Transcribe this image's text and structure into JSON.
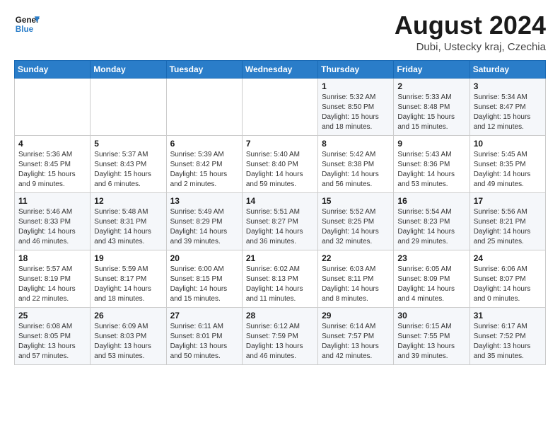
{
  "header": {
    "logo": {
      "line1": "General",
      "line2": "Blue"
    },
    "title": "August 2024",
    "subtitle": "Dubi, Ustecky kraj, Czechia"
  },
  "weekdays": [
    "Sunday",
    "Monday",
    "Tuesday",
    "Wednesday",
    "Thursday",
    "Friday",
    "Saturday"
  ],
  "weeks": [
    [
      {
        "day": "",
        "info": ""
      },
      {
        "day": "",
        "info": ""
      },
      {
        "day": "",
        "info": ""
      },
      {
        "day": "",
        "info": ""
      },
      {
        "day": "1",
        "info": "Sunrise: 5:32 AM\nSunset: 8:50 PM\nDaylight: 15 hours\nand 18 minutes."
      },
      {
        "day": "2",
        "info": "Sunrise: 5:33 AM\nSunset: 8:48 PM\nDaylight: 15 hours\nand 15 minutes."
      },
      {
        "day": "3",
        "info": "Sunrise: 5:34 AM\nSunset: 8:47 PM\nDaylight: 15 hours\nand 12 minutes."
      }
    ],
    [
      {
        "day": "4",
        "info": "Sunrise: 5:36 AM\nSunset: 8:45 PM\nDaylight: 15 hours\nand 9 minutes."
      },
      {
        "day": "5",
        "info": "Sunrise: 5:37 AM\nSunset: 8:43 PM\nDaylight: 15 hours\nand 6 minutes."
      },
      {
        "day": "6",
        "info": "Sunrise: 5:39 AM\nSunset: 8:42 PM\nDaylight: 15 hours\nand 2 minutes."
      },
      {
        "day": "7",
        "info": "Sunrise: 5:40 AM\nSunset: 8:40 PM\nDaylight: 14 hours\nand 59 minutes."
      },
      {
        "day": "8",
        "info": "Sunrise: 5:42 AM\nSunset: 8:38 PM\nDaylight: 14 hours\nand 56 minutes."
      },
      {
        "day": "9",
        "info": "Sunrise: 5:43 AM\nSunset: 8:36 PM\nDaylight: 14 hours\nand 53 minutes."
      },
      {
        "day": "10",
        "info": "Sunrise: 5:45 AM\nSunset: 8:35 PM\nDaylight: 14 hours\nand 49 minutes."
      }
    ],
    [
      {
        "day": "11",
        "info": "Sunrise: 5:46 AM\nSunset: 8:33 PM\nDaylight: 14 hours\nand 46 minutes."
      },
      {
        "day": "12",
        "info": "Sunrise: 5:48 AM\nSunset: 8:31 PM\nDaylight: 14 hours\nand 43 minutes."
      },
      {
        "day": "13",
        "info": "Sunrise: 5:49 AM\nSunset: 8:29 PM\nDaylight: 14 hours\nand 39 minutes."
      },
      {
        "day": "14",
        "info": "Sunrise: 5:51 AM\nSunset: 8:27 PM\nDaylight: 14 hours\nand 36 minutes."
      },
      {
        "day": "15",
        "info": "Sunrise: 5:52 AM\nSunset: 8:25 PM\nDaylight: 14 hours\nand 32 minutes."
      },
      {
        "day": "16",
        "info": "Sunrise: 5:54 AM\nSunset: 8:23 PM\nDaylight: 14 hours\nand 29 minutes."
      },
      {
        "day": "17",
        "info": "Sunrise: 5:56 AM\nSunset: 8:21 PM\nDaylight: 14 hours\nand 25 minutes."
      }
    ],
    [
      {
        "day": "18",
        "info": "Sunrise: 5:57 AM\nSunset: 8:19 PM\nDaylight: 14 hours\nand 22 minutes."
      },
      {
        "day": "19",
        "info": "Sunrise: 5:59 AM\nSunset: 8:17 PM\nDaylight: 14 hours\nand 18 minutes."
      },
      {
        "day": "20",
        "info": "Sunrise: 6:00 AM\nSunset: 8:15 PM\nDaylight: 14 hours\nand 15 minutes."
      },
      {
        "day": "21",
        "info": "Sunrise: 6:02 AM\nSunset: 8:13 PM\nDaylight: 14 hours\nand 11 minutes."
      },
      {
        "day": "22",
        "info": "Sunrise: 6:03 AM\nSunset: 8:11 PM\nDaylight: 14 hours\nand 8 minutes."
      },
      {
        "day": "23",
        "info": "Sunrise: 6:05 AM\nSunset: 8:09 PM\nDaylight: 14 hours\nand 4 minutes."
      },
      {
        "day": "24",
        "info": "Sunrise: 6:06 AM\nSunset: 8:07 PM\nDaylight: 14 hours\nand 0 minutes."
      }
    ],
    [
      {
        "day": "25",
        "info": "Sunrise: 6:08 AM\nSunset: 8:05 PM\nDaylight: 13 hours\nand 57 minutes."
      },
      {
        "day": "26",
        "info": "Sunrise: 6:09 AM\nSunset: 8:03 PM\nDaylight: 13 hours\nand 53 minutes."
      },
      {
        "day": "27",
        "info": "Sunrise: 6:11 AM\nSunset: 8:01 PM\nDaylight: 13 hours\nand 50 minutes."
      },
      {
        "day": "28",
        "info": "Sunrise: 6:12 AM\nSunset: 7:59 PM\nDaylight: 13 hours\nand 46 minutes."
      },
      {
        "day": "29",
        "info": "Sunrise: 6:14 AM\nSunset: 7:57 PM\nDaylight: 13 hours\nand 42 minutes."
      },
      {
        "day": "30",
        "info": "Sunrise: 6:15 AM\nSunset: 7:55 PM\nDaylight: 13 hours\nand 39 minutes."
      },
      {
        "day": "31",
        "info": "Sunrise: 6:17 AM\nSunset: 7:52 PM\nDaylight: 13 hours\nand 35 minutes."
      }
    ]
  ]
}
